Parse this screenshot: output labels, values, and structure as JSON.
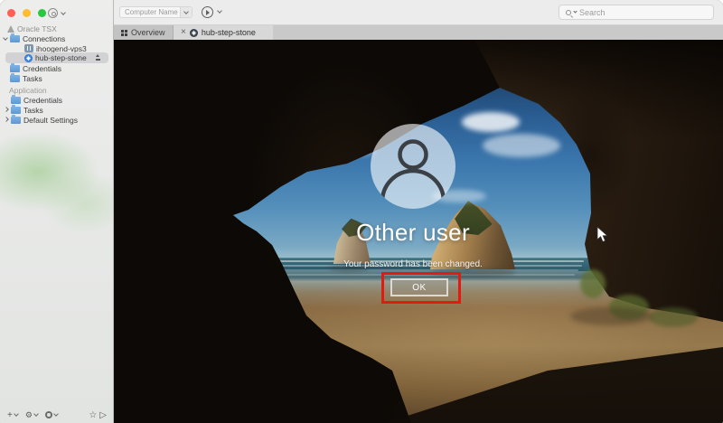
{
  "colors": {
    "accent_red": "#e21b11",
    "folder_blue": "#5e9ad8",
    "selection_gray": "#d2d2d4",
    "traffic_red": "#ff5f57",
    "traffic_yellow": "#febc2e",
    "traffic_green": "#28c840"
  },
  "sidebar": {
    "tree": [
      {
        "label": "Oracle TSX",
        "icon": "warning"
      },
      {
        "label": "Connections",
        "icon": "folder",
        "expanded": true
      },
      {
        "label": "ihoogend-vps3",
        "icon": "remote-display"
      },
      {
        "label": "hub-step-stone",
        "icon": "connection",
        "selected": true,
        "trailing_icon": "eject"
      },
      {
        "label": "Credentials",
        "icon": "folder"
      },
      {
        "label": "Tasks",
        "icon": "folder"
      },
      {
        "label": "Application",
        "type": "section-header"
      },
      {
        "label": "Credentials",
        "icon": "folder"
      },
      {
        "label": "Tasks",
        "icon": "folder",
        "collapsed": true
      },
      {
        "label": "Default Settings",
        "icon": "folder",
        "collapsed": true
      }
    ],
    "footer": {
      "add": "+",
      "favorite": "☆",
      "run": "▷",
      "settings": "⚙"
    }
  },
  "toolbar": {
    "computer_name_placeholder": "Computer Name",
    "search_placeholder": "Search"
  },
  "tabs": [
    {
      "label": "Overview"
    },
    {
      "label": "hub-step-stone",
      "active": true
    }
  ],
  "icons": {
    "close_tab": "×"
  },
  "lock_screen": {
    "user_label": "Other user",
    "message": "Your password has been changed.",
    "ok_button": "OK"
  }
}
